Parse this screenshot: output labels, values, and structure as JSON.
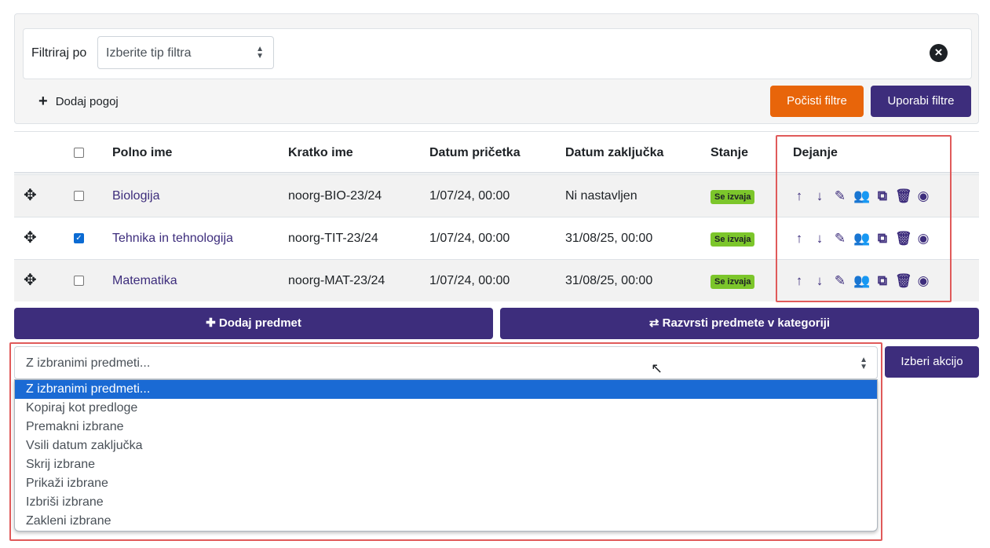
{
  "filters": {
    "label": "Filtriraj po",
    "select_placeholder": "Izberite tip filtra",
    "add_condition": "Dodaj pogoj",
    "clear_button": "Počisti filtre",
    "apply_button": "Uporabi filtre"
  },
  "table": {
    "headers": {
      "full_name": "Polno ime",
      "short_name": "Kratko ime",
      "start_date": "Datum pričetka",
      "end_date": "Datum zaključka",
      "status": "Stanje",
      "actions": "Dejanje"
    },
    "rows": [
      {
        "full_name": "Biologija",
        "short_name": "noorg-BIO-23/24",
        "start": "1/07/24, 00:00",
        "end": "Ni nastavljen",
        "status": "Se izvaja",
        "checked": false
      },
      {
        "full_name": "Tehnika in tehnologija",
        "short_name": "noorg-TIT-23/24",
        "start": "1/07/24, 00:00",
        "end": "31/08/25, 00:00",
        "status": "Se izvaja",
        "checked": true
      },
      {
        "full_name": "Matematika",
        "short_name": "noorg-MAT-23/24",
        "start": "1/07/24, 00:00",
        "end": "31/08/25, 00:00",
        "status": "Se izvaja",
        "checked": false
      }
    ],
    "action_icons": [
      "arrow-up-icon",
      "arrow-down-icon",
      "pencil-icon",
      "users-icon",
      "copy-icon",
      "trash-icon",
      "eye-icon"
    ]
  },
  "buttons": {
    "add_course": "Dodaj predmet",
    "sort_courses": "Razvrsti predmete v kategoriji",
    "choose_action": "Izberi akcijo"
  },
  "bulk": {
    "selected": "Z izbranimi predmeti...",
    "options": [
      "Z izbranimi predmeti...",
      "Kopiraj kot predloge",
      "Premakni izbrane",
      "Vsili datum zaključka",
      "Skrij izbrane",
      "Prikaži izbrane",
      "Izbriši izbrane",
      "Zakleni izbrane"
    ]
  },
  "colors": {
    "primary": "#3d2d7c",
    "warning": "#e8650a",
    "success": "#7cc62b",
    "highlight": "#e05a5a"
  }
}
